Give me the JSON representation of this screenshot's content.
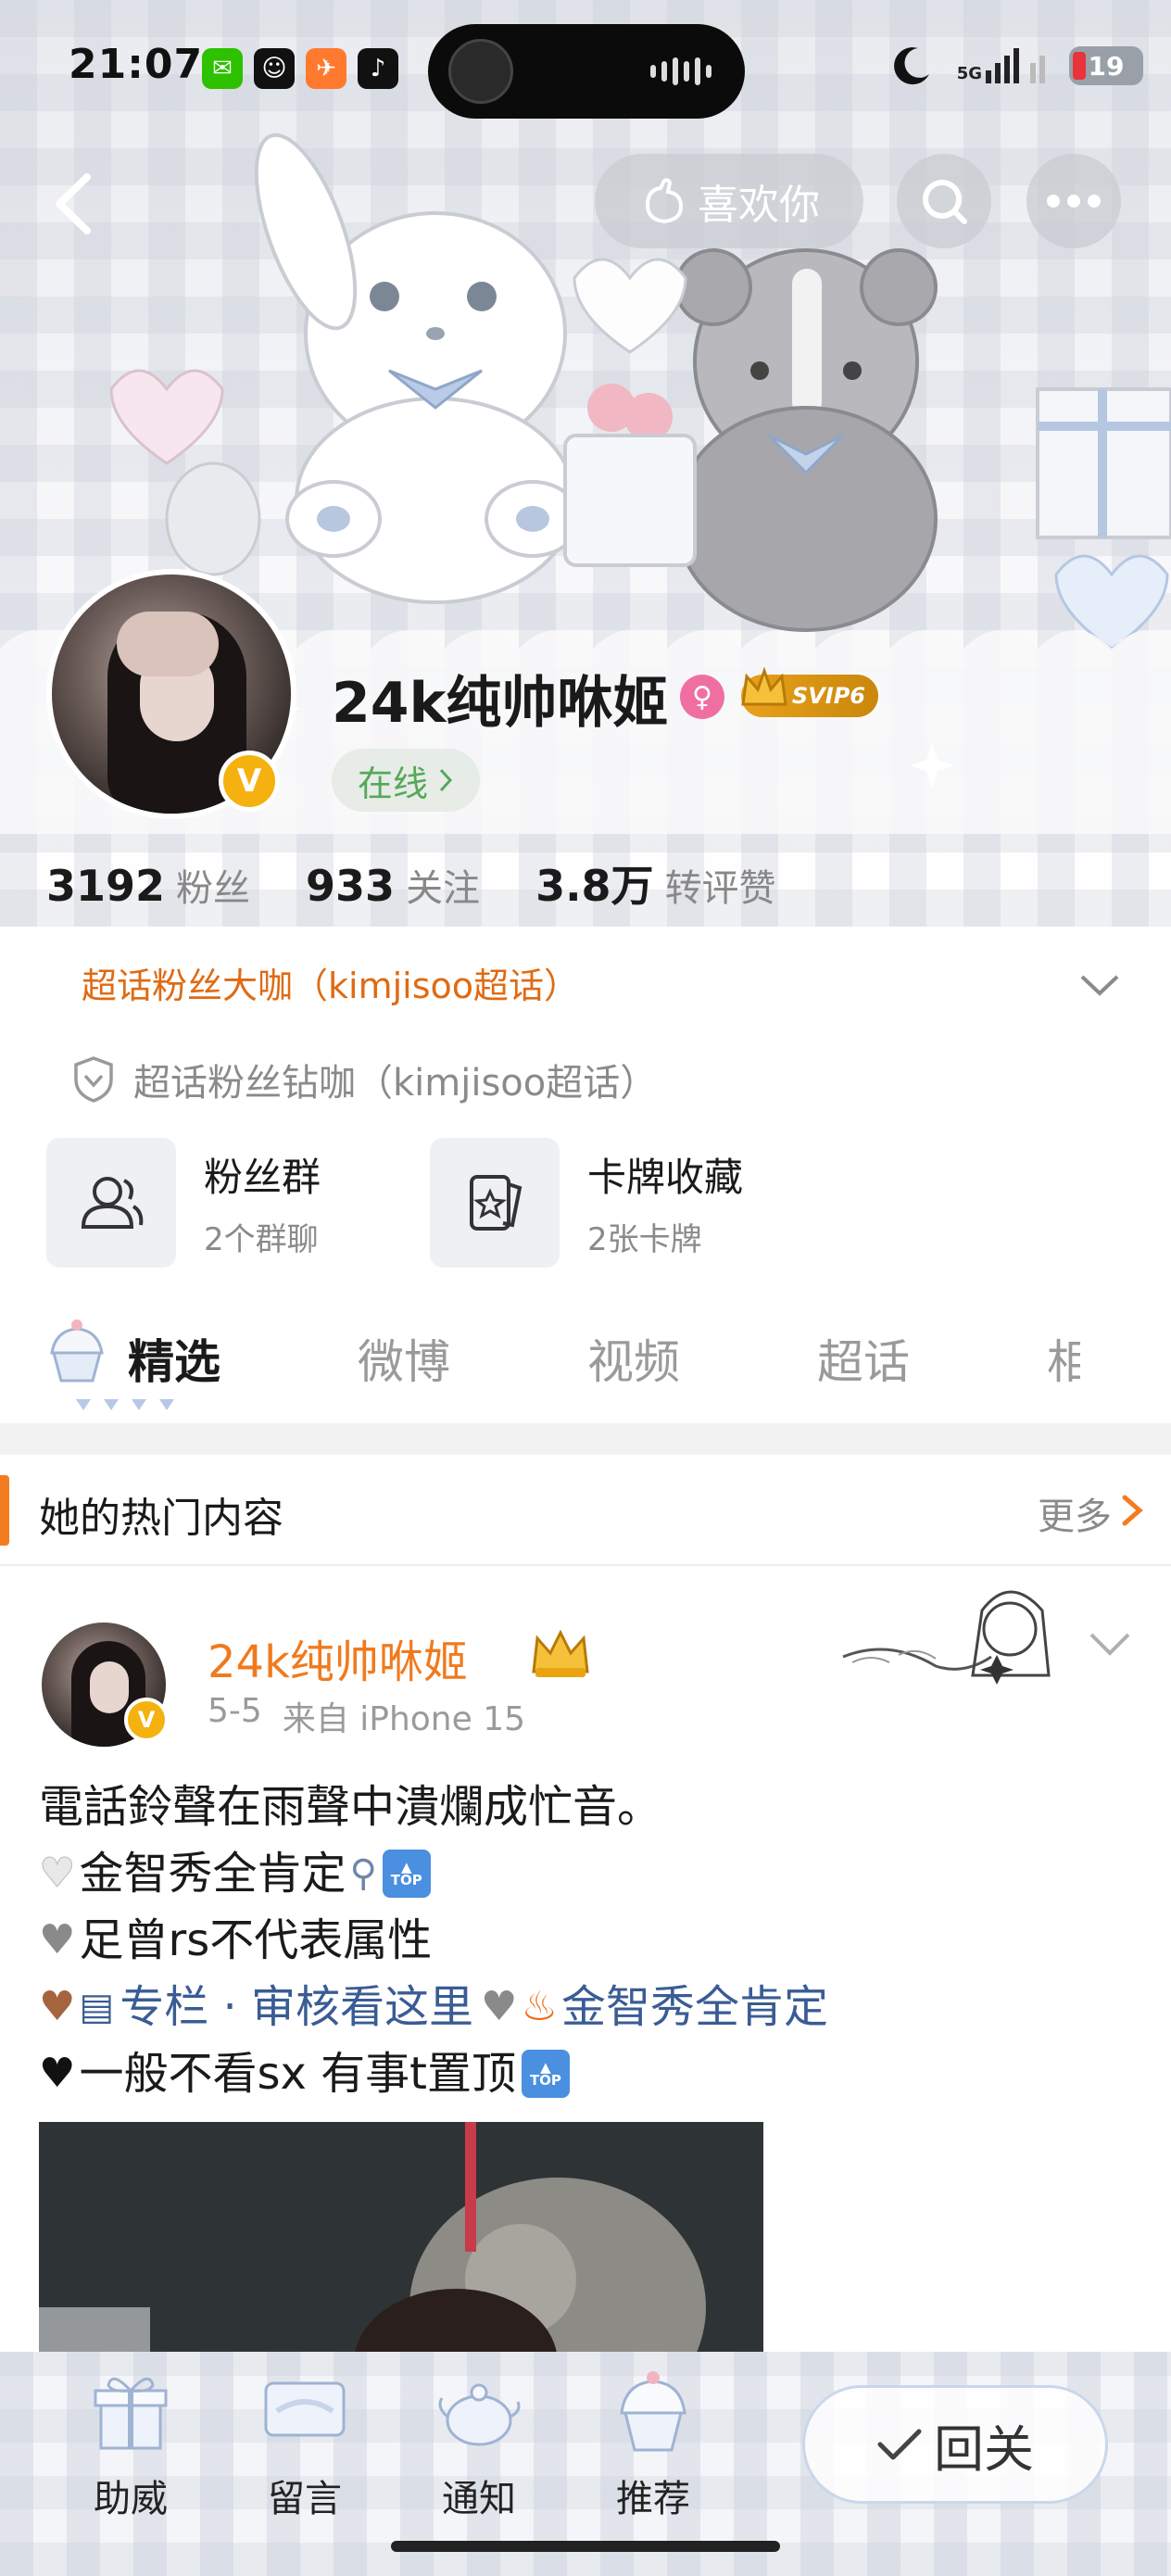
{
  "status_bar": {
    "time": "21:07",
    "network": "5G",
    "battery": "19",
    "app_icons": [
      "wechat-icon",
      "smile-app-icon",
      "run-app-icon",
      "tiktok-icon"
    ]
  },
  "nav": {
    "like_label": "喜欢你"
  },
  "profile": {
    "username": "24k纯帅咻姬",
    "svip_label": "SVIP6",
    "online_label": "在线",
    "stats": [
      {
        "num": "3192",
        "label": "粉丝"
      },
      {
        "num": "933",
        "label": "关注"
      },
      {
        "num": "3.8万",
        "label": "转评赞"
      }
    ],
    "fan_rank": "超话粉丝大咖（kimjisoo超话）",
    "fan_level": "超话粉丝钻咖（kimjisoo超话）"
  },
  "cards": [
    {
      "title": "粉丝群",
      "sub": "2个群聊"
    },
    {
      "title": "卡牌收藏",
      "sub": "2张卡牌"
    }
  ],
  "tabs": [
    "精选",
    "微博",
    "视频",
    "超话",
    "相"
  ],
  "hot": {
    "title": "她的热门内容",
    "more": "更多"
  },
  "post": {
    "author": "24k纯帅咻姬",
    "date": "5-5",
    "source": "来自 iPhone 15",
    "line1": "電話鈴聲在雨聲中潰爛成忙音。",
    "line2": "金智秀全肯定",
    "line3": "足曾rs不代表属性",
    "line4_link1": "专栏 · 审核看这里",
    "line4_link2": "金智秀全肯定",
    "line5": "一般不看sx 有事t置顶",
    "top_emoji_label": "TOP"
  },
  "bottom_bar": {
    "items": [
      "助威",
      "留言",
      "通知",
      "推荐"
    ],
    "follow_label": "回关"
  },
  "colors": {
    "accent_orange": "#f07a1e",
    "online_green": "#56a85a",
    "link_blue": "#3a5c94",
    "vip_gold": "#f5b10f"
  }
}
